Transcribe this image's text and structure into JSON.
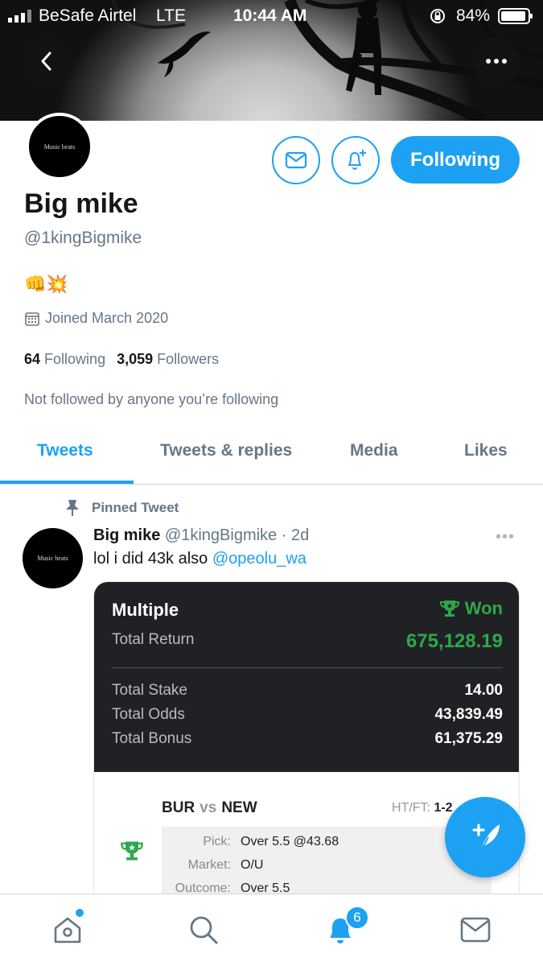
{
  "status_bar": {
    "carrier": "BeSafe Airtel",
    "network": "LTE",
    "time": "10:44 AM",
    "battery": "84%"
  },
  "profile": {
    "avatar_text": "Music beats",
    "name": "Big mike",
    "handle": "@1kingBigmike",
    "bio": "👊💥",
    "joined": "Joined March 2020",
    "following_count": "64",
    "following_label": "Following",
    "followers_count": "3,059",
    "followers_label": "Followers",
    "not_followed": "Not followed by anyone you’re following",
    "follow_button": "Following"
  },
  "tabs": [
    {
      "label": "Tweets",
      "active": true
    },
    {
      "label": "Tweets & replies",
      "active": false
    },
    {
      "label": "Media",
      "active": false
    },
    {
      "label": "Likes",
      "active": false
    }
  ],
  "tweet": {
    "pinned_label": "Pinned Tweet",
    "author": "Big mike",
    "handle": "@1kingBigmike",
    "time": "· 2d",
    "text": "lol i did 43k also ",
    "mention": "@opeolu_wa"
  },
  "bet_slip": {
    "title": "Multiple",
    "status": "Won",
    "total_return_label": "Total Return",
    "total_return": "675,128.19",
    "rows": [
      {
        "label": "Total Stake",
        "value": "14.00"
      },
      {
        "label": "Total Odds",
        "value": "43,839.49"
      },
      {
        "label": "Total Bonus",
        "value": "61,375.29"
      }
    ],
    "match": {
      "home": "BUR",
      "vs": "vs",
      "away": "NEW",
      "htft_label": "HT/FT:",
      "htft_value": "1-2"
    },
    "pick_label": "Pick:",
    "pick": "Over 5.5 @43.68",
    "market_label": "Market:",
    "market": "O/U",
    "outcome_label": "Outcome:",
    "outcome": "Over 5.5"
  },
  "bottom_nav": {
    "notifications_badge": "6"
  },
  "colors": {
    "accent": "#1da1f2",
    "won_green": "#2ea84a",
    "card_dark": "#202124"
  }
}
